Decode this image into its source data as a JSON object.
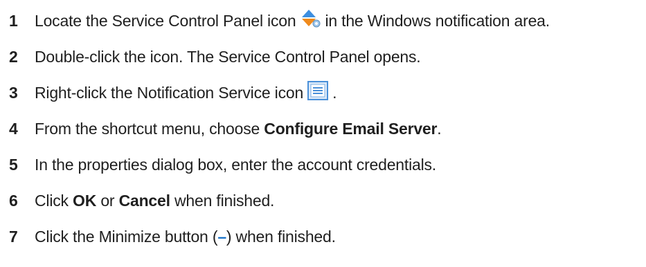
{
  "steps": [
    {
      "number": "1",
      "before": "Locate the Service Control Panel icon",
      "icon": "service-control-panel-icon",
      "after": "in the Windows notification area."
    },
    {
      "number": "2",
      "text": "Double-click the icon. The Service Control Panel opens."
    },
    {
      "number": "3",
      "before": "Right-click the Notification Service icon",
      "icon": "notification-service-icon",
      "after": "."
    },
    {
      "number": "4",
      "before": "From the shortcut menu, choose ",
      "bold": "Configure Email Server",
      "after": "."
    },
    {
      "number": "5",
      "text": "In the properties dialog box, enter the account credentials."
    },
    {
      "number": "6",
      "before": "Click ",
      "bold1": "OK",
      "mid": " or ",
      "bold2": "Cancel",
      "after": " when finished."
    },
    {
      "number": "7",
      "before": "Click the Minimize button (",
      "symbol": "–",
      "after": ") when finished."
    }
  ],
  "colors": {
    "minimize_symbol": "#1a73c9",
    "scp_icon_top": "#3d8fe0",
    "scp_icon_bottom": "#f08a1c",
    "ns_icon_border": "#4a90d9"
  }
}
